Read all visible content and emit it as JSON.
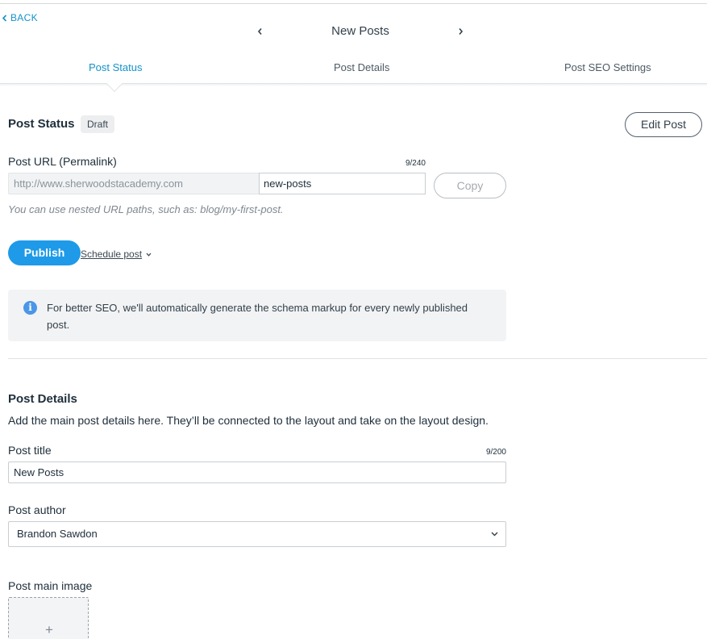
{
  "header": {
    "back_label": "BACK",
    "title": "New Posts"
  },
  "tabs": [
    {
      "label": "Post Status",
      "active": true
    },
    {
      "label": "Post Details",
      "active": false
    },
    {
      "label": "Post SEO Settings",
      "active": false
    }
  ],
  "status": {
    "title": "Post Status",
    "badge": "Draft",
    "edit_button": "Edit Post",
    "url_label": "Post URL (Permalink)",
    "url_counter": "9/240",
    "url_prefix": "http://www.sherwoodstacademy.com",
    "url_slug": "new-posts",
    "copy_button": "Copy",
    "url_hint": "You can use nested URL paths, such as: blog/my-first-post.",
    "publish_button": "Publish",
    "schedule_link": "Schedule post",
    "info_text": "For better SEO, we'll automatically generate the schema markup for every newly published post."
  },
  "details": {
    "title": "Post Details",
    "description": "Add the main post details here. They’ll be connected to the layout and take on the layout design.",
    "post_title_label": "Post title",
    "post_title_counter": "9/200",
    "post_title_value": "New Posts",
    "author_label": "Post author",
    "author_value": "Brandon Sawdon",
    "main_image_label": "Post main image",
    "main_image_add": "+"
  },
  "colors": {
    "accent": "#1592c9",
    "publish": "#1e9ae8",
    "info_icon": "#4a96e8"
  }
}
